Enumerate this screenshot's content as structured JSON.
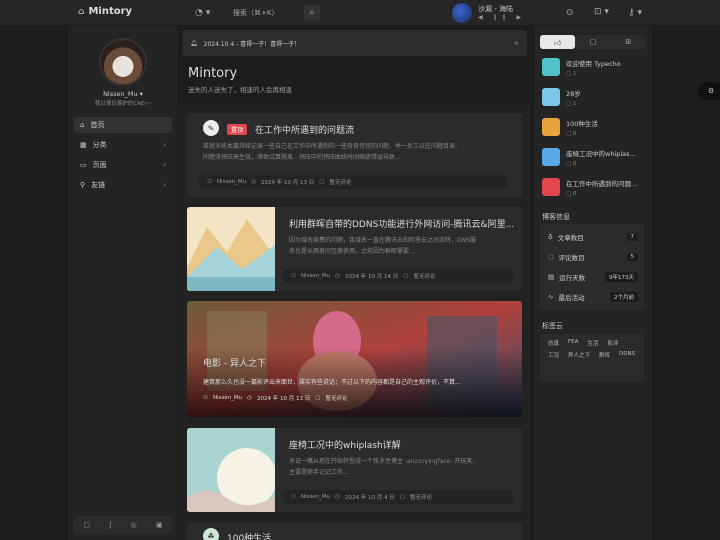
{
  "header": {
    "brand": "Mintory",
    "search_label": "搜索（⌘+K）",
    "music_title": "沙漏 - 海陆",
    "music_controls": "◀ ❙❙ ▶"
  },
  "profile": {
    "name": "Nissen_Mu ▾",
    "desc": "我以律日善妒的CAEr~"
  },
  "nav": [
    {
      "label": "首页",
      "icon": "⌂"
    },
    {
      "label": "分类",
      "icon": "▦"
    },
    {
      "label": "页面",
      "icon": "▭"
    },
    {
      "label": "友链",
      "icon": "⚲"
    }
  ],
  "notice": {
    "text": "2024.10.4 - 喜得一子！喜得一子！"
  },
  "site": {
    "title": "Mintory",
    "subtitle": "迷失的人迷失了，相逢的人会再相逢"
  },
  "posts": [
    {
      "title": "在工作中所遇到的问题流",
      "badge": "置顶",
      "excerpt1": "菜就多练本篇持续记录一些自己在工作中所遇到的一些奇奇怪怪的问题，举一反三以往问题目录:",
      "excerpt2": "问题流预压来生效，沸估试算脱离 - 预压中的预压曲线时间缩放错误导致...",
      "author": "Nissen_Mu",
      "date": "2024 年 10 月 13 日",
      "comments": "暂无评论"
    },
    {
      "title": "利用群晖自带的DDNS功能进行外网访问-腾讯云&阿里...",
      "excerpt1": "因为域名续费的问题，我域名一直在腾讯云和阿里云之间流转，DNS服",
      "excerpt2": "务也是从两者间互换使用，之前因为群晖需要...",
      "author": "Nissen_Mu",
      "date": "2024 年 10 月 14 日",
      "comments": "暂无评论"
    },
    {
      "title": "电影 - 异人之下",
      "excerpt1": "建筑那么久也没一篇影评出来面世，属实有些说话；不过以下的内容都是自己的主观评价，不算...",
      "author": "Nissen_Mu",
      "date": "2024 年 10 月 13 日",
      "comments": "暂无评论"
    },
    {
      "title": "座椅工况中的whiplash详解",
      "excerpt1": "多说一嘴从现在开始转型成一个技术性博主 :aru:cryingface: 开玩笑，",
      "excerpt2": "主要是随手记记工作...",
      "author": "Nissen_Mu",
      "date": "2024 年 10 月 4 日",
      "comments": "暂无评论"
    },
    {
      "title": "100种生活"
    }
  ],
  "recent": [
    {
      "title": "欢迎使用 Typecho",
      "count": "1",
      "color": "#4fc3c8"
    },
    {
      "title": "28岁",
      "count": "1",
      "color": "#7ac7e8"
    },
    {
      "title": "100种生活",
      "count": "0",
      "color": "#e8a23c"
    },
    {
      "title": "座椅工况中的whiplas...",
      "count": "0",
      "color": "#5aa9e6"
    },
    {
      "title": "在工作中所遇到的问题...",
      "count": "0",
      "color": "#e2474f"
    }
  ],
  "stats": {
    "title": "博客信息",
    "rows": [
      {
        "label": "文章数目",
        "value": "7",
        "icon": "♁"
      },
      {
        "label": "评论数目",
        "value": "5",
        "icon": "◌"
      },
      {
        "label": "运行天数",
        "value": "9年173天",
        "icon": "▤"
      },
      {
        "label": "最后活动",
        "value": "2个月前",
        "icon": "∿"
      }
    ]
  },
  "tags": {
    "title": "标签云",
    "items": [
      "仿真",
      "FEA",
      "生活",
      "影评",
      "工况",
      "异人之下",
      "群晖",
      "DDNS"
    ]
  }
}
